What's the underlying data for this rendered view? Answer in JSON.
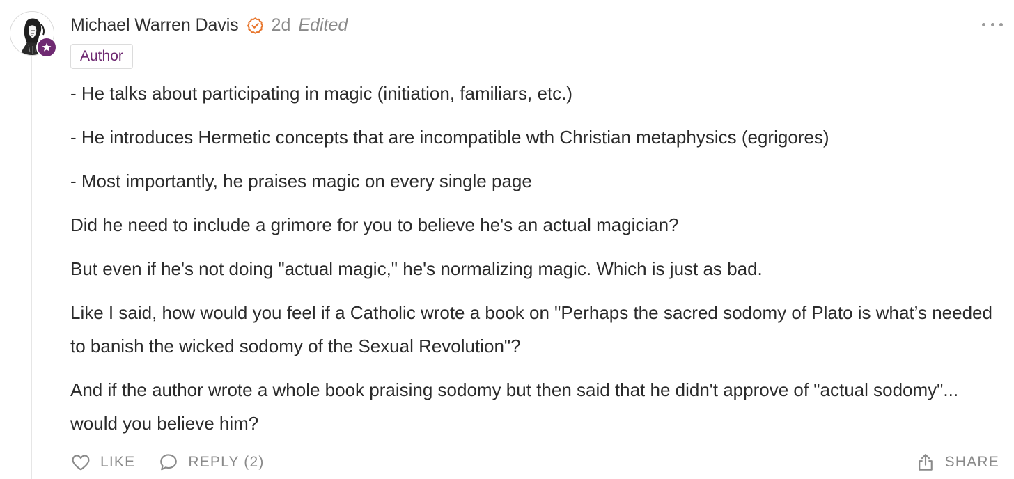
{
  "comment": {
    "author": "Michael Warren Davis",
    "time": "2d",
    "edited": "Edited",
    "badge": "Author",
    "paragraphs": [
      "- He talks about participating in magic (initiation, familiars, etc.)",
      "- He introduces Hermetic concepts that are incompatible wth Christian metaphysics (egrigores)",
      "- Most importantly, he praises magic on every single page",
      "Did he need to include a grimore for you to believe he's an actual magician?",
      "But even if he's not doing \"actual magic,\" he's normalizing magic. Which is just as bad.",
      "Like I said, how would you feel if a Catholic wrote a book on \"Perhaps the sacred sodomy of Plato is what’s needed to banish the wicked sodomy of the Sexual Revolution\"?",
      "And if the author wrote a whole book praising sodomy but then said that he didn't approve of \"actual sodomy\"... would you believe him?"
    ],
    "actions": {
      "like": "LIKE",
      "reply": "REPLY (2)",
      "share": "SHARE"
    }
  },
  "icons": {
    "avatar": "author-portrait",
    "author_marker": "star-icon",
    "verified": "check-circle-icon",
    "more": "more-horizontal-icon",
    "like": "heart-icon",
    "reply": "speech-bubble-icon",
    "share": "share-icon"
  },
  "colors": {
    "accent": "#6f2a72",
    "verified": "#e8762d",
    "muted": "#8a8a8a",
    "text": "#2b2b2b"
  }
}
